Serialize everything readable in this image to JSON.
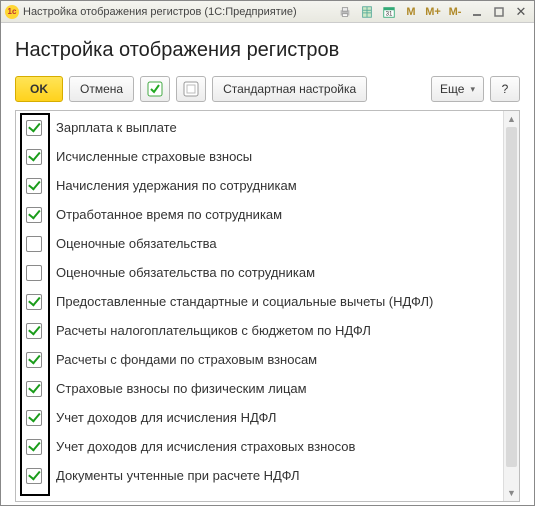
{
  "window": {
    "title": "Настройка отображения регистров  (1С:Предприятие)"
  },
  "page": {
    "heading": "Настройка отображения регистров"
  },
  "toolbar": {
    "ok": "OK",
    "cancel": "Отмена",
    "standard": "Стандартная настройка",
    "more": "Еще",
    "help": "?"
  },
  "items": [
    {
      "label": "Зарплата к выплате",
      "checked": true
    },
    {
      "label": "Исчисленные страховые взносы",
      "checked": true
    },
    {
      "label": "Начисления удержания по сотрудникам",
      "checked": true
    },
    {
      "label": "Отработанное время по сотрудникам",
      "checked": true
    },
    {
      "label": "Оценочные обязательства",
      "checked": false
    },
    {
      "label": "Оценочные обязательства по сотрудникам",
      "checked": false
    },
    {
      "label": "Предоставленные стандартные и социальные вычеты (НДФЛ)",
      "checked": true
    },
    {
      "label": "Расчеты налогоплательщиков с бюджетом по НДФЛ",
      "checked": true
    },
    {
      "label": "Расчеты с фондами по страховым взносам",
      "checked": true
    },
    {
      "label": "Страховые взносы по физическим лицам",
      "checked": true
    },
    {
      "label": "Учет доходов для исчисления НДФЛ",
      "checked": true
    },
    {
      "label": "Учет доходов для исчисления страховых взносов",
      "checked": true
    },
    {
      "label": "Документы учтенные при расчете НДФЛ",
      "checked": true
    }
  ]
}
